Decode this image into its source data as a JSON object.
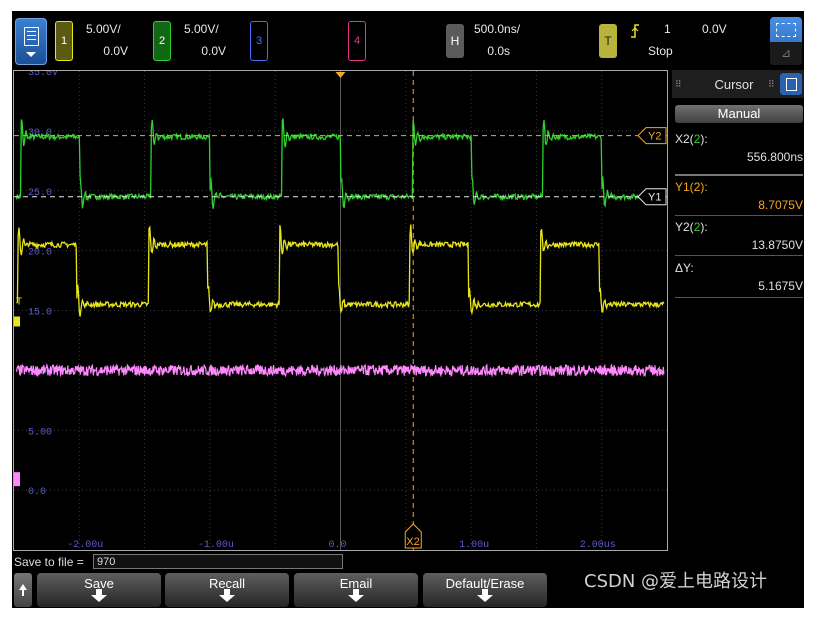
{
  "colors": {
    "ch1": "#e8e61a",
    "ch2": "#2ed22e",
    "ch3": "#4b6cf5",
    "ch4": "#ff88ff",
    "cursor": "#f5a623",
    "ch4_box": "#e8358f"
  },
  "top": {
    "ch1": {
      "num": "1",
      "scale": "5.00V/",
      "offset": "0.0V"
    },
    "ch2": {
      "num": "2",
      "scale": "5.00V/",
      "offset": "0.0V"
    },
    "ch3": {
      "num": "3"
    },
    "ch4": {
      "num": "4"
    },
    "horizontal": {
      "label": "H",
      "timebase": "500.0ns/",
      "delay": "0.0s"
    },
    "trigger": {
      "label": "T",
      "source": "1",
      "level": "0.0V",
      "state": "Stop"
    }
  },
  "graticule": {
    "y_labels": [
      "35.0V",
      "30.0",
      "25.0",
      "20.0",
      "15.0",
      "10.0",
      "5.00",
      "0.0"
    ],
    "x_labels": [
      "-2.00u",
      "-1.00u",
      "0.0",
      "1.00u",
      "2.00us"
    ],
    "cursor_labels": {
      "y2": "Y2",
      "y1": "Y1",
      "x2": "X2",
      "t": "T"
    }
  },
  "cursor_panel": {
    "title": "Cursor",
    "mode": "Manual",
    "rows": [
      {
        "label": "X2(2):",
        "value": "556.800ns",
        "color": "#e0e0e0"
      },
      {
        "label": "Y1(2):",
        "value": "8.7075V",
        "color": "#f5a623"
      },
      {
        "label": "Y2(2):",
        "value": "13.8750V",
        "color": "#e0e0e0"
      },
      {
        "label": "ΔY:",
        "value": "5.1675V",
        "color": "#e0e0e0"
      }
    ]
  },
  "bottom": {
    "save_label": "Save to file =",
    "filename": "970",
    "softkeys": [
      "Save",
      "Recall",
      "Email",
      "Default/Erase"
    ]
  },
  "watermark": "CSDN @爱上电路设计",
  "chart_data": {
    "type": "line",
    "title": "",
    "xlabel": "",
    "ylabel": "",
    "xlim_us": [
      -2.5,
      2.5
    ],
    "ylim_V": [
      -5,
      35
    ],
    "grid": true,
    "series": [
      {
        "name": "",
        "channel": "2",
        "color": "#2ed22e",
        "period_us": 1.0,
        "high_V": 29.5,
        "low_V": 24.5,
        "duty": 0.45,
        "first_rise_us": -2.45
      },
      {
        "name": "",
        "channel": "1",
        "color": "#e8e61a",
        "period_us": 1.0,
        "high_V": 20.5,
        "low_V": 15.5,
        "duty": 0.55,
        "first_fall_us": -2.02
      },
      {
        "name": "",
        "channel": "4",
        "color": "#ff88ff",
        "level_V": 10.0
      }
    ],
    "cursors": {
      "x2_us": 0.557,
      "y1_V": 24.5,
      "y2_V": 29.6
    }
  }
}
